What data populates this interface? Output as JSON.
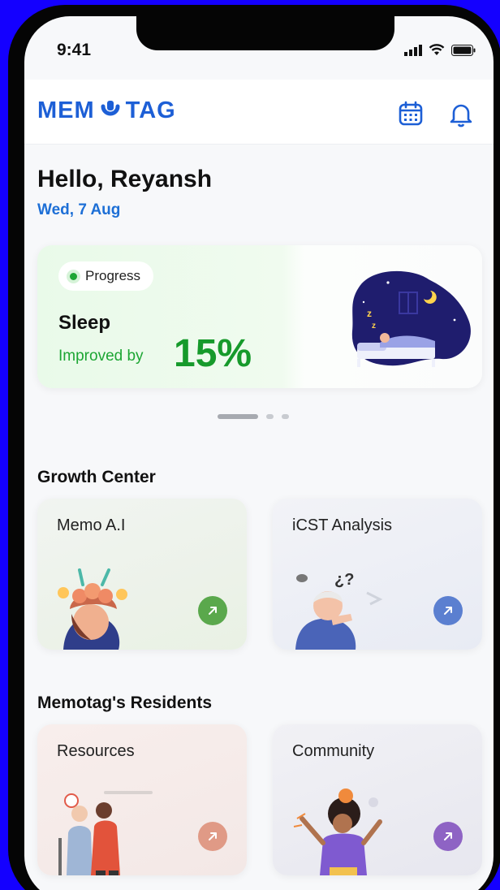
{
  "status_bar": {
    "time": "9:41"
  },
  "header": {
    "logo_left": "MEM",
    "logo_right": "TAG"
  },
  "greeting": {
    "text": "Hello, Reyansh",
    "date": "Wed, 7 Aug"
  },
  "progress_card": {
    "badge": "Progress",
    "title": "Sleep",
    "subtitle": "Improved by",
    "value": "15%",
    "carousel": {
      "total": 3,
      "active": 1
    }
  },
  "growth_center": {
    "title": "Growth Center",
    "tiles": [
      {
        "label": "Memo A.I",
        "accent": "#5aa84c"
      },
      {
        "label": "iCST Analysis",
        "accent": "#5b7fd0"
      }
    ]
  },
  "residents": {
    "title": "Memotag's Residents",
    "tiles": [
      {
        "label": "Resources",
        "accent": "#e09a86"
      },
      {
        "label": "Community",
        "accent": "#8e63c4"
      }
    ]
  },
  "colors": {
    "brand": "#1d5fd6",
    "date": "#1d6fd6",
    "progress_green": "#169a2b"
  }
}
